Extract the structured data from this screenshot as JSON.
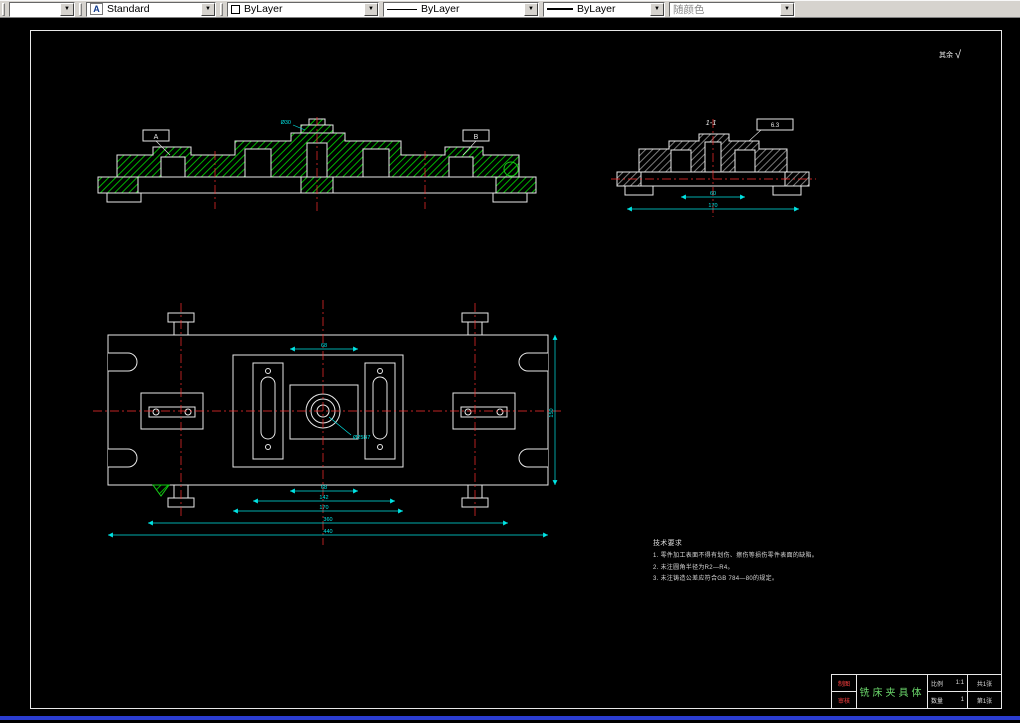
{
  "toolbar": {
    "style": "Standard",
    "color": "ByLayer",
    "linetype": "ByLayer",
    "lineweight": "ByLayer",
    "plot_style": "随颜色"
  },
  "icons": {
    "dropdown_arrow": "▼",
    "style_glyph": "A",
    "check": "√"
  },
  "corner_finish": "其余",
  "views": {
    "front": {
      "datum_left": "A",
      "datum_right": "B",
      "top_dim": "Ø30"
    },
    "side": {
      "section_label": "1-1",
      "finish_label": "6.3",
      "dims": [
        "60",
        "170"
      ]
    },
    "plan": {
      "center_label": "Ø25H7",
      "dims": [
        "68",
        "142",
        "170",
        "360",
        "440",
        "150"
      ]
    }
  },
  "notes": {
    "title": "技术要求",
    "lines": [
      "1. 零件加工表面不得有划伤、擦伤等损伤零件表面的缺陷。",
      "2. 未注圆角半径为R2—R4。",
      "3. 未注铸造公差应符合GB 784—80的规定。"
    ]
  },
  "titleblock": {
    "title": "铣床夹具体",
    "drawn_label": "制图",
    "checked_label": "审核",
    "scale_label": "比例",
    "scale_value": "1:1",
    "qty_label": "数量",
    "qty_value": "1",
    "sheet_label": "共1张",
    "page_label": "第1张"
  },
  "colors": {
    "outline": "#e8e8e8",
    "centerline": "#ff3030",
    "hatch": "#00b400",
    "dimension": "#00e5e5"
  }
}
